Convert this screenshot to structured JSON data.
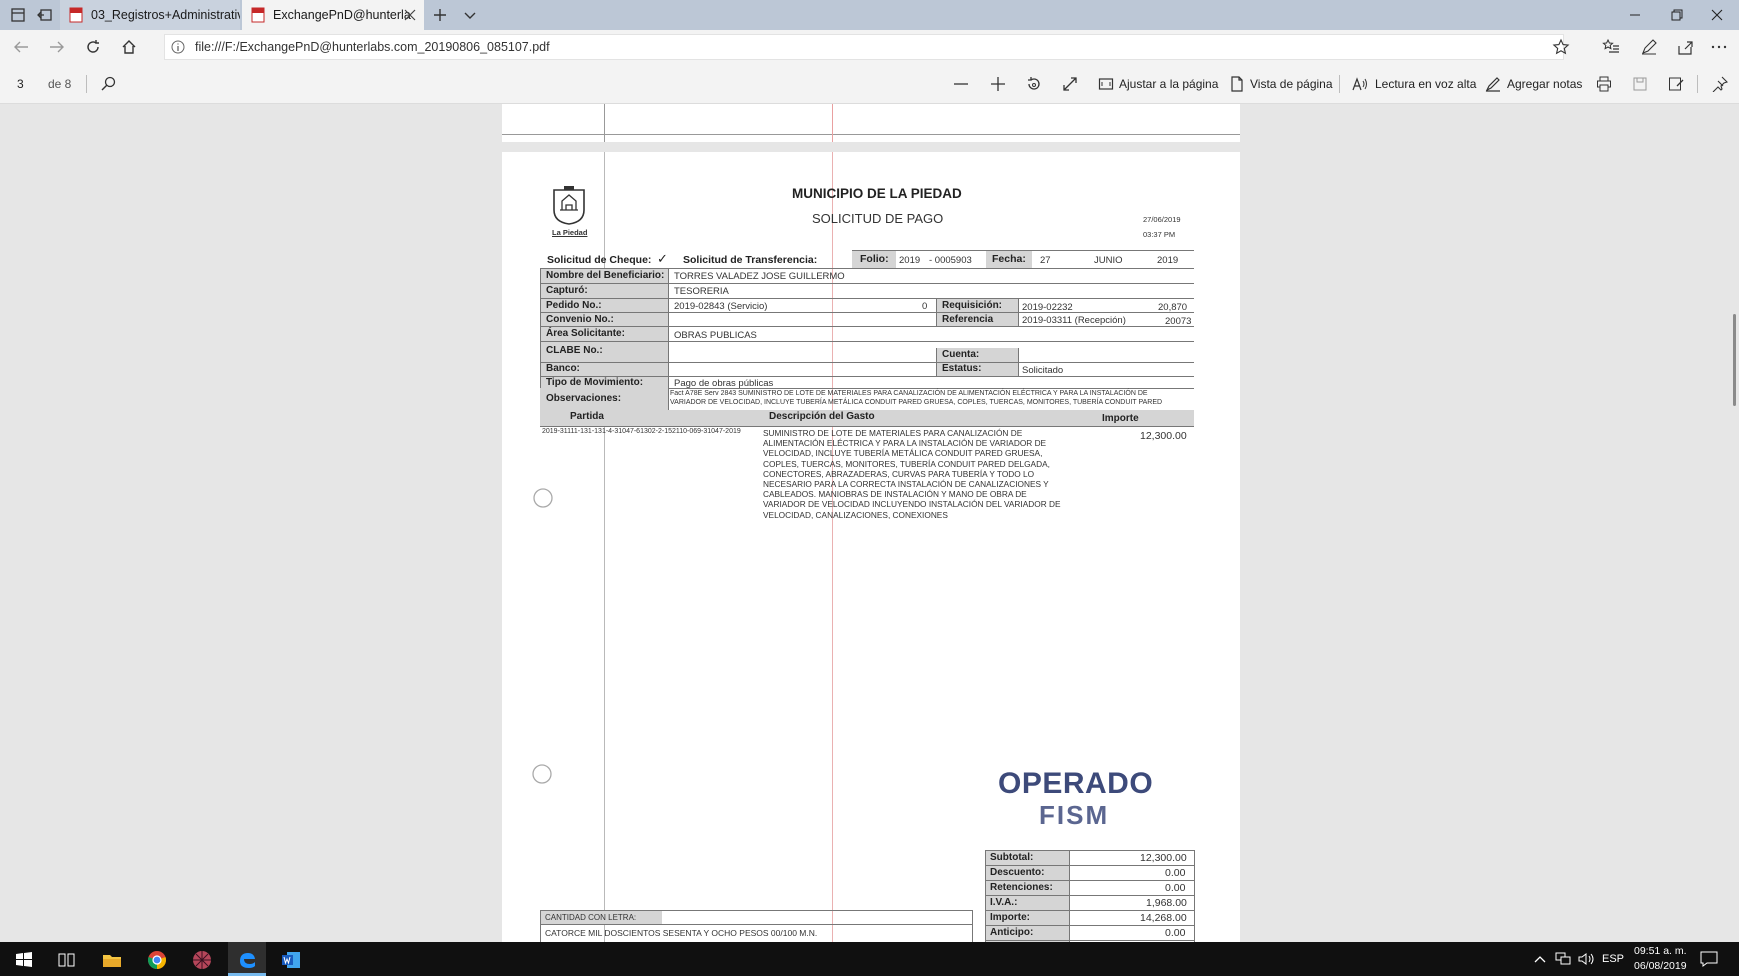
{
  "browser": {
    "tabs": [
      {
        "label": "03_Registros+Administrativ",
        "active": false
      },
      {
        "label": "ExchangePnD@hunterla",
        "active": true
      }
    ],
    "url": "file:///F:/ExchangePnD@hunterlabs.com_20190806_085107.pdf"
  },
  "pdf_toolbar": {
    "page_current": "3",
    "page_total_label": "de 8",
    "fit_page": "Ajustar a la página",
    "page_view": "Vista de página",
    "read_aloud": "Lectura en voz alta",
    "add_notes": "Agregar notas"
  },
  "document": {
    "logo_caption": "La Piedad",
    "title": "MUNICIPIO DE LA PIEDAD",
    "subtitle": "SOLICITUD DE PAGO",
    "print_date": "27/06/2019",
    "print_time": "03:37 PM",
    "check_label": "Solicitud de Cheque:",
    "check_mark": "✓",
    "transfer_label": "Solicitud de Transferencia:",
    "folio_label": "Folio:",
    "folio_year": "2019",
    "folio_number": "- 0005903",
    "fecha_label": "Fecha:",
    "fecha_day": "27",
    "fecha_month": "JUNIO",
    "fecha_year": "2019",
    "beneficiario_label": "Nombre del Beneficiario:",
    "beneficiario": "TORRES VALADEZ JOSE GUILLERMO",
    "capturo_label": "Capturó:",
    "capturo": "TESORERIA",
    "pedido_label": "Pedido No.:",
    "pedido": "2019-02843 (Servicio)",
    "pedido_amount": "0",
    "requisicion_label": "Requisición:",
    "requisicion": "2019-02232",
    "requisicion_num": "20,870",
    "convenio_label": "Convenio No.:",
    "referencia_label": "Referencia",
    "referencia": "2019-03311 (Recepción)",
    "referencia_num": "20073",
    "area_label": "Área Solicitante:",
    "area": "OBRAS PUBLICAS",
    "clabe_label": "CLABE No.:",
    "cuenta_label": "Cuenta:",
    "banco_label": "Banco:",
    "estatus_label": "Estatus:",
    "estatus": "Solicitado",
    "tipo_label": "Tipo de Movimiento:",
    "tipo": "Pago de obras públicas",
    "observaciones_label": "Observaciones:",
    "observaciones_1": "Fact A78E Serv 2843 SUMINISTRO DE LOTE DE MATERIALES PARA CANALIZACIÓN DE ALIMENTACIÓN ELÉCTRICA Y PARA LA INSTALACIÓN DE",
    "observaciones_2": "VARIADOR DE VELOCIDAD, INCLUYE TUBERÍA METÁLICA CONDUIT PARED GRUESA, COPLES, TUERCAS, MONITORES, TUBERÍA CONDUIT PARED",
    "col_partida": "Partida",
    "col_descripcion": "Descripción del Gasto",
    "col_importe": "Importe",
    "partida_code": "2019-31111-131-131-4-31047-61302-2-152110-069-31047-2019",
    "descripcion_lines": [
      "SUMINISTRO DE LOTE DE MATERIALES PARA CANALIZACIÓN DE",
      "ALIMENTACIÓN ELÉCTRICA Y PARA LA INSTALACIÓN DE VARIADOR DE",
      "VELOCIDAD, INCLUYE TUBERÍA METÁLICA CONDUIT PARED GRUESA,",
      "COPLES, TUERCAS, MONITORES, TUBERÍA CONDUIT PARED DELGADA,",
      "CONECTORES, ABRAZADERAS, CURVAS PARA TUBERÍA Y TODO LO",
      "NECESARIO PARA LA CORRECTA INSTALACIÓN DE CANALIZACIONES Y",
      "CABLEADOS. MANIOBRAS DE INSTALACIÓN Y MANO DE OBRA DE",
      "VARIADOR DE VELOCIDAD INCLUYENDO INSTALACIÓN DEL VARIADOR DE",
      "VELOCIDAD, CANALIZACIONES, CONEXIONES"
    ],
    "importe": "12,300.00",
    "stamp_line1": "OPERADO",
    "stamp_line2": "FISM",
    "totals": [
      {
        "label": "Subtotal:",
        "value": "12,300.00"
      },
      {
        "label": "Descuento:",
        "value": "0.00"
      },
      {
        "label": "Retenciones:",
        "value": "0.00"
      },
      {
        "label": "I.V.A.:",
        "value": "1,968.00"
      },
      {
        "label": "Importe:",
        "value": "14,268.00"
      },
      {
        "label": "Anticipo:",
        "value": "0.00"
      }
    ],
    "cantidad_label": "CANTIDAD CON LETRA:",
    "cantidad": "CATORCE MIL DOSCIENTOS SESENTA Y OCHO PESOS 00/100 M.N."
  },
  "taskbar": {
    "language": "ESP",
    "time": "09:51 a. m.",
    "date": "06/08/2019"
  }
}
